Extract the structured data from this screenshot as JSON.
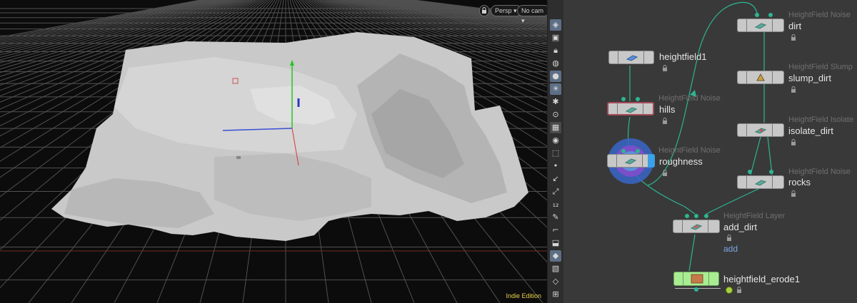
{
  "viewport": {
    "lock_icon": "lock-icon",
    "view_mode": "Persp",
    "camera": "No cam",
    "edition": "Indie Edition"
  },
  "toolbar": {
    "icons": [
      "display-options-icon",
      "viewport-layout-icon",
      "lock-view-icon",
      "shading-sphere-icon",
      "light-bulb-icon",
      "headlight-icon",
      "scene-light-icon",
      "checker-icon",
      "ghost-icon",
      "visualizer-icon",
      "point-icon",
      "normal-icon",
      "vector-icon",
      "point-numbers-icon",
      "paint-icon",
      "primitive-icon",
      "snapshot-icon",
      "wireframe-icon",
      "background-icon",
      "guide-icon"
    ]
  },
  "network": {
    "nodes": [
      {
        "id": "heightfield1",
        "type_label": "",
        "name": "heightfield1"
      },
      {
        "id": "hills",
        "type_label": "HeightField Noise",
        "name": "hills"
      },
      {
        "id": "roughness",
        "type_label": "HeightField Noise",
        "name": "roughness"
      },
      {
        "id": "dirt",
        "type_label": "HeightField Noise",
        "name": "dirt"
      },
      {
        "id": "slump_dirt",
        "type_label": "HeightField Slump",
        "name": "slump_dirt"
      },
      {
        "id": "isolate_dirt",
        "type_label": "HeightField Isolate",
        "name": "isolate_dirt"
      },
      {
        "id": "rocks",
        "type_label": "HeightField Noise",
        "name": "rocks"
      },
      {
        "id": "add_dirt",
        "type_label": "HeightField Layer",
        "name": "add_dirt",
        "sub_label": "add"
      },
      {
        "id": "heightfield_erode1",
        "type_label": "",
        "name": "heightfield_erode1"
      }
    ],
    "colors": {
      "wire": "#2db592",
      "node": "#c8c8c8",
      "selected_ring": "#3a66c8",
      "erode_node": "#a9ed92",
      "add_label": "#7fa6e6"
    }
  }
}
